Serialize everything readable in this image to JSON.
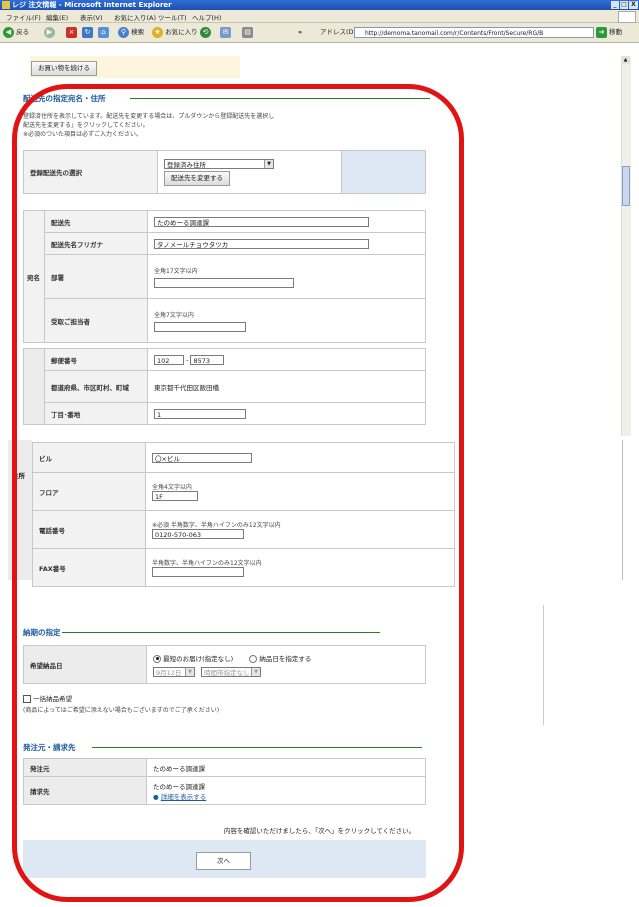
{
  "window": {
    "title": "レジ 注文情報 - Microsoft Internet Explorer",
    "controls": [
      "_",
      "□",
      "X"
    ]
  },
  "menu": [
    "ファイル(F)",
    "編集(E)",
    "表示(V)",
    "お気に入り(A)",
    "ツール(T)",
    "ヘルプ(H)"
  ],
  "toolbar": {
    "back": "戻る",
    "search": "検索",
    "favorites": "お気に入り",
    "address_label": "アドレス(D)",
    "url": "http://demoma.tanomail.com/r/Contents/Front/Secure/RG/B",
    "go": "移動"
  },
  "continue_button": "お買い物を続ける",
  "delivery": {
    "section_title": "配送先の指定宛名・住所",
    "notes": [
      "登録済住所を表示しています。配送先を変更する場合は、プルダウンから登録配送先を選択し",
      "配送先を変更する」をクリックしてください。",
      "※必須のついた項目は必ずご入力ください。"
    ],
    "registered_label": "登録配送先の選択",
    "registered_select": "登録済み住所",
    "change_button": "配送先を変更する",
    "group_name": "宛名",
    "group_address": "住所",
    "fields": {
      "dest_label": "配送先",
      "dest_value": "たのめーる調達課",
      "kana_label": "配送先名フリガナ",
      "kana_value": "タノメールチョウタツカ",
      "dept_label": "部署",
      "dept_hint": "全角17文字以内",
      "person_label": "受取ご担当者",
      "person_hint": "全角7文字以内",
      "zip_label": "郵便番号",
      "zip1": "102",
      "zip2": "8573",
      "pref_label": "都道府県、市区町村、町域",
      "pref_value": "東京都千代田区飯田橋",
      "chome_label": "丁目･番地",
      "chome_value": "1",
      "bldg_label": "ビル",
      "bldg_value": "〇×ビル",
      "floor_label": "フロア",
      "floor_hint": "全角4文字以内",
      "floor_value": "1F",
      "tel_label": "電話番号",
      "tel_hint": "※必須 半角数字、半角ハイフンのみ12文字以内",
      "tel_value": "0120-570-063",
      "fax_label": "FAX番号",
      "fax_hint": "半角数字、半角ハイフンのみ12文字以内"
    }
  },
  "delivery_date": {
    "section_title": "納期の指定",
    "date_label": "希望納品日",
    "option_fastest": "最短のお届け(指定なし)",
    "option_specify": "納品日を指定する",
    "date_select": "9月12日",
    "time_select": "時間帯指定なし",
    "bulk_label": "一括納品希望",
    "bulk_note": "(商品によってはご希望に添えない場合もございますのでご了承ください)"
  },
  "billing": {
    "section_title": "発注元・請求先",
    "orderer_label": "発注元",
    "orderer_value": "たのめーる調達課",
    "billing_label": "請求先",
    "billing_value": "たのめーる調達課",
    "details_link": "詳細を表示する"
  },
  "footer": {
    "confirm_text": "内容を確認いただけましたら、「次へ」をクリックしてください。",
    "next_button": "次へ"
  },
  "colors": {
    "accent_red": "#e11414",
    "section_blue": "#1c5aa0",
    "line_green": "#2d7a2d",
    "panel_blue": "#dde8f4"
  }
}
